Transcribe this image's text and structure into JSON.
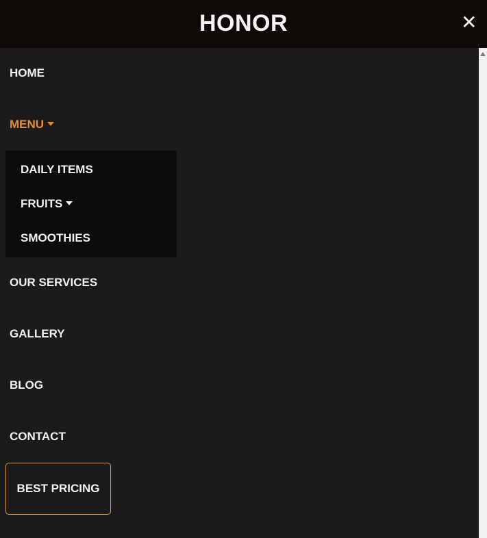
{
  "brand": {
    "title": "HONOR"
  },
  "header": {
    "close_glyph": "✕",
    "close_icon": "close-icon"
  },
  "nav": {
    "home": "HOME",
    "menu": "MENU",
    "our_services": "OUR SERVICES",
    "gallery": "GALLERY",
    "blog": "BLOG",
    "contact": "CONTACT"
  },
  "submenu": {
    "daily_items": "DAILY ITEMS",
    "fruits": "FRUITS",
    "smoothies": "SMOOTHIES"
  },
  "cta": {
    "label": "BEST PRICING"
  },
  "colors": {
    "accent": "#e58f2c",
    "background": "#1b1b1b",
    "header_background": "#0d0a07",
    "submenu_background": "#0c0c0c"
  }
}
